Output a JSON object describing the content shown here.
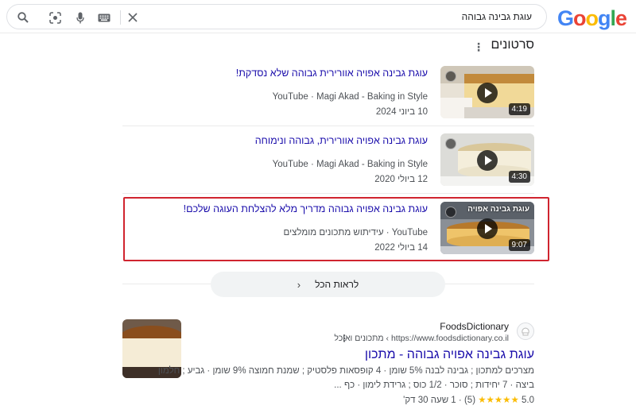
{
  "header": {
    "logo_letters": [
      "G",
      "o",
      "o",
      "g",
      "l",
      "e"
    ],
    "query": "עוגת גבינה גבוהה",
    "icons": [
      "close-icon",
      "keyboard-icon",
      "mic-icon",
      "lens-icon",
      "search-icon"
    ]
  },
  "videos_section": {
    "title": "סרטונים",
    "items": [
      {
        "title": "עוגת גבינה אפויה אוורירית גבוהה שלא נסדקת!",
        "meta": "YouTube · Magi Akad - Baking in Style",
        "date": "10 ביוני 2024",
        "duration": "4:19"
      },
      {
        "title": "עוגת גבינה אפויה אוורירית, גבוהה ונימוחה",
        "meta": "YouTube · Magi Akad - Baking in Style",
        "date": "12 ביולי 2020",
        "duration": "4:30"
      },
      {
        "title": "עוגת גבינה אפויה גבוהה מדריך מלא להצלחת העוגה שלכם!",
        "meta": "YouTube · עידיתוש מתכונים מומלצים",
        "date": "14 ביולי 2022",
        "duration": "9:07",
        "thumb_caption": "עוגת גבינה אפויה"
      }
    ],
    "see_all": "לראות הכל"
  },
  "result": {
    "site_name": "FoodsDictionary",
    "site_url": "https://www.foodsdictionary.co.il › מתכונים ואוכל",
    "title": "עוגת גבינה אפויה גבוהה - מתכון",
    "snippet_line1": "מצרכים למתכון ; גבינה לבנה 5% שומן · 4 קופסאות פלסטיק ; שמנת חמוצה 9% שומן · גביע ; חלמון",
    "snippet_line2": "ביצה · 7 יחידות ; סוכר · 1/2 כוס ; גרידת לימון · כף ...",
    "rating_value": "5.0",
    "rating_count": "(5)",
    "time": "1 שעה 30 דק'",
    "stars": "★★★★★"
  }
}
